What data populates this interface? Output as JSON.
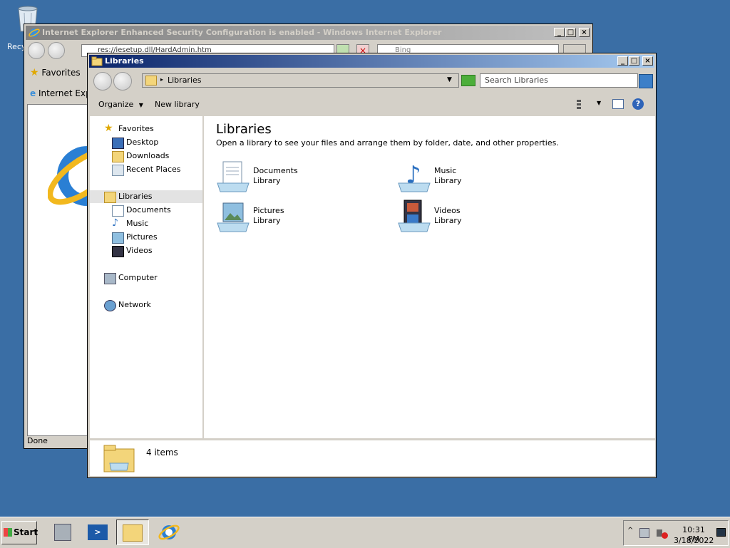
{
  "desktop": {
    "recycle_label": "Recy"
  },
  "ie": {
    "title": "Internet Explorer Enhanced Security Configuration is enabled - Windows Internet Explorer",
    "address": "res://iesetup.dll/HardAdmin.htm",
    "search_placeholder": "Bing",
    "favorites_label": "Favorites",
    "tab_label": "Internet Explor",
    "status": "Done"
  },
  "explorer": {
    "title": "Libraries",
    "breadcrumb": "Libraries",
    "search_placeholder": "Search Libraries",
    "toolbar": {
      "organize": "Organize",
      "new_library": "New library"
    },
    "nav": {
      "favorites": "Favorites",
      "desktop": "Desktop",
      "downloads": "Downloads",
      "recent_places": "Recent Places",
      "libraries": "Libraries",
      "documents": "Documents",
      "music": "Music",
      "pictures": "Pictures",
      "videos": "Videos",
      "computer": "Computer",
      "network": "Network"
    },
    "heading": "Libraries",
    "description": "Open a library to see your files and arrange them by folder, date, and other properties.",
    "libraries": [
      {
        "name": "Documents",
        "type": "Library"
      },
      {
        "name": "Music",
        "type": "Library"
      },
      {
        "name": "Pictures",
        "type": "Library"
      },
      {
        "name": "Videos",
        "type": "Library"
      }
    ],
    "item_count": "4 items"
  },
  "taskbar": {
    "start_label": "Start",
    "time": "10:31 PM",
    "date": "3/18/2022"
  },
  "colors": {
    "desktop": "#3a6ea5",
    "active_title": "#0a246a",
    "inactive_title": "#808080"
  }
}
